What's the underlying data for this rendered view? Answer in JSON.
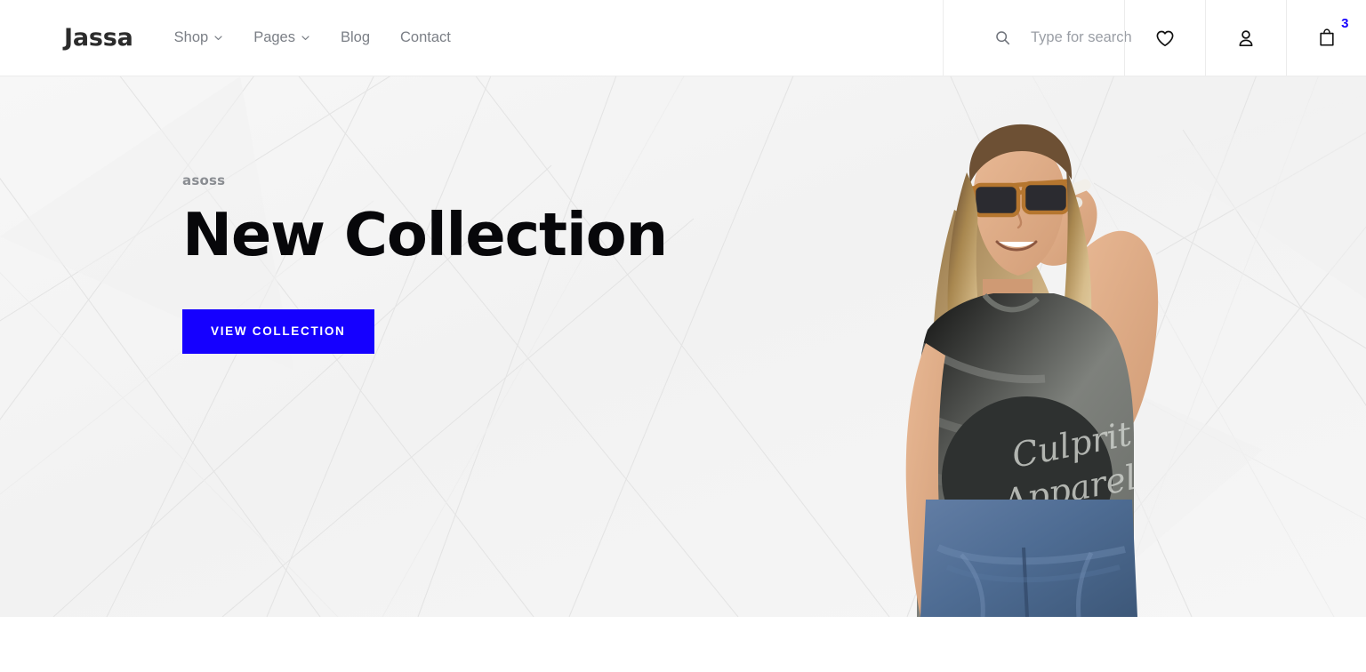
{
  "brand": {
    "name": "Jassa"
  },
  "nav": {
    "items": [
      {
        "label": "Shop",
        "has_dropdown": true
      },
      {
        "label": "Pages",
        "has_dropdown": true
      },
      {
        "label": "Blog",
        "has_dropdown": false
      },
      {
        "label": "Contact",
        "has_dropdown": false
      }
    ]
  },
  "search": {
    "placeholder": "Type for search",
    "value": "",
    "icon": "search-icon"
  },
  "actions": {
    "wishlist_icon": "heart-icon",
    "account_icon": "user-icon",
    "cart_icon": "shopping-bag-icon",
    "cart_count": "3"
  },
  "hero": {
    "eyebrow": "asoss",
    "title": "New Collection",
    "cta_label": "VIEW COLLECTION",
    "image_alt": "Woman in grey Culprit Apparel t-shirt, sunglasses and blue jeans"
  },
  "colors": {
    "accent": "#1500FF",
    "hero_bg": "#F4F4F4",
    "text_dark": "#07070A",
    "text_muted": "#7B7F86",
    "eyebrow": "#8A8D92",
    "border": "#ECECEC",
    "page_bg": "#FFFFFF"
  }
}
